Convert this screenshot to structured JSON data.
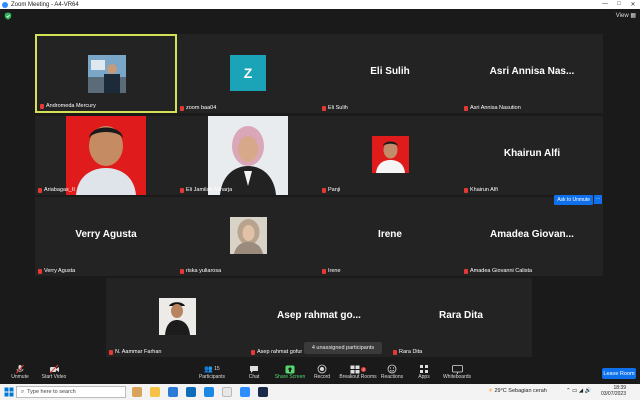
{
  "window": {
    "title": "Zoom Meeting - A4-VR64",
    "controls": [
      "—",
      "□",
      "✕"
    ]
  },
  "topbar": {
    "view_label": "View"
  },
  "participants": [
    {
      "id": "andromeda",
      "name": "Andromeda Mercury",
      "display": "",
      "type": "video"
    },
    {
      "id": "zoom",
      "name": "zoom baa04",
      "display": "Z",
      "type": "letter"
    },
    {
      "id": "eli",
      "name": "Eli Sulih",
      "display": "Eli Sulih",
      "type": "name"
    },
    {
      "id": "asri",
      "name": "Asri Annisa Nasution",
      "display": "Asri Annisa Nas...",
      "type": "name"
    },
    {
      "id": "ariabagas",
      "name": "Ariabagas_II",
      "display": "",
      "type": "video"
    },
    {
      "id": "elijamilah",
      "name": "Eli Jamilah Miharja",
      "display": "",
      "type": "video"
    },
    {
      "id": "panji",
      "name": "Panji",
      "display": "",
      "type": "video"
    },
    {
      "id": "khairun",
      "name": "Khairun Alfi",
      "display": "Khairun Alfi",
      "type": "name"
    },
    {
      "id": "verry",
      "name": "Verry Agusta",
      "display": "Verry Agusta",
      "type": "name"
    },
    {
      "id": "riska",
      "name": "riska yuliarosa",
      "display": "",
      "type": "video"
    },
    {
      "id": "irene",
      "name": "Irene",
      "display": "Irene",
      "type": "name"
    },
    {
      "id": "amadea",
      "name": "Amadea Giovanni Calista",
      "display": "Amadea Giovan...",
      "type": "name"
    },
    {
      "id": "aammar",
      "name": "N. Aammar Farhan",
      "display": "",
      "type": "video"
    },
    {
      "id": "asep",
      "name": "Asep rahmat gofur",
      "display": "Asep rahmat go...",
      "type": "name"
    },
    {
      "id": "rara",
      "name": "Rara Dita",
      "display": "Rara Dita",
      "type": "name"
    }
  ],
  "ask_unmute": "Ask to Unmute",
  "ask_more": "···",
  "unassigned_popup": "4 unassigned participants",
  "toolbar": {
    "unmute": "Unmute",
    "start_video": "Start Video",
    "participants": "Participants",
    "participants_count": "15",
    "chat": "Chat",
    "share_screen": "Share Screen",
    "record": "Record",
    "breakout_rooms": "Breakout Rooms",
    "breakout_badge": "4",
    "reactions": "Reactions",
    "apps": "Apps",
    "whiteboards": "Whiteboards",
    "leave": "Leave Room"
  },
  "taskbar": {
    "search_placeholder": "Type here to search",
    "weather": "29°C  Sebagian cerah",
    "time": "18:39",
    "date": "03/07/2023"
  },
  "colors": {
    "active_border": "#d4e157",
    "accent": "#0e71eb",
    "mic_off": "#e53935",
    "share": "#55d86f"
  }
}
